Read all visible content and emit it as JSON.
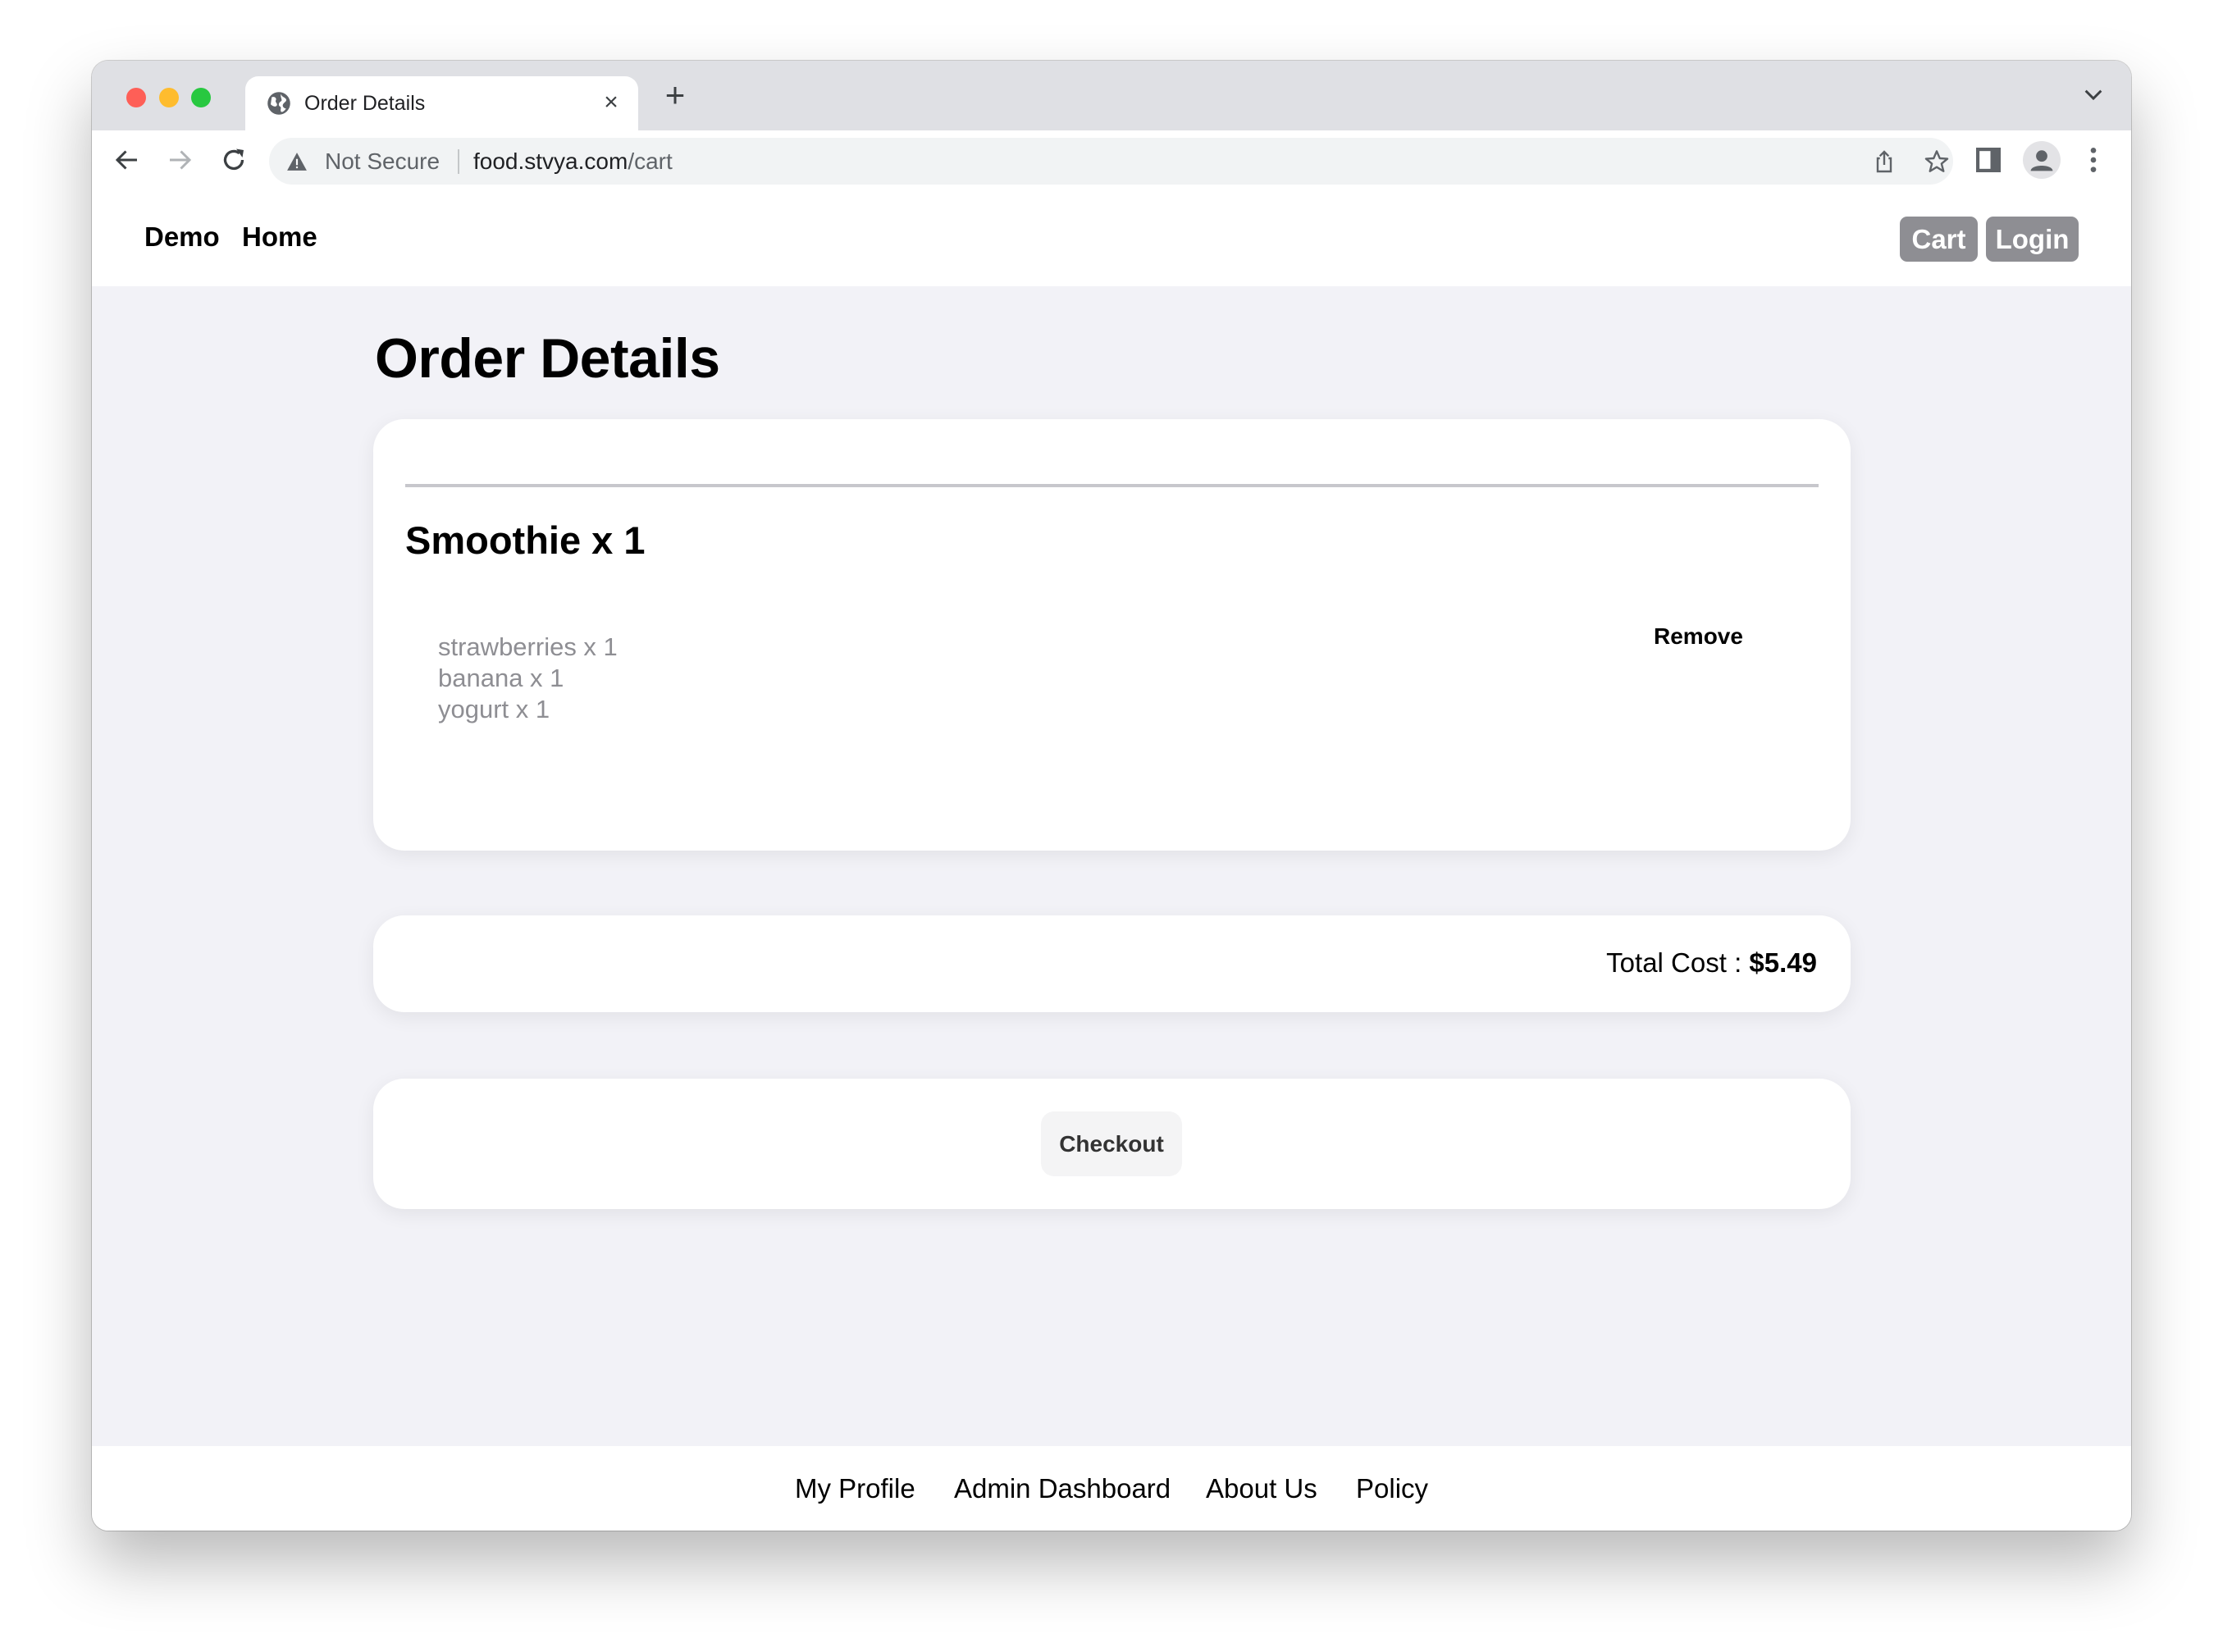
{
  "browser": {
    "tab_title": "Order Details",
    "tab_close": "×",
    "new_tab": "+",
    "security_label": "Not Secure",
    "url_host": "food.stvya.com",
    "url_path": "/cart",
    "icons": [
      "globe-icon",
      "close-icon",
      "plus-icon",
      "chevron-down-icon",
      "back-arrow-icon",
      "forward-arrow-icon",
      "reload-icon",
      "warning-icon",
      "share-icon",
      "star-icon",
      "sidebar-icon",
      "profile-icon",
      "more-vert-icon"
    ]
  },
  "nav": {
    "brand": "Demo",
    "home": "Home",
    "cart": "Cart",
    "login": "Login"
  },
  "page": {
    "title": "Order Details"
  },
  "order": {
    "items": [
      {
        "name": "Smoothie x 1",
        "ingredients": [
          "strawberries x 1",
          "banana x 1",
          "yogurt x 1"
        ],
        "remove_label": "Remove"
      }
    ],
    "total_label": "Total Cost : ",
    "total_value": "$5.49",
    "checkout_label": "Checkout"
  },
  "footer": {
    "links": [
      "My Profile",
      "Admin Dashboard",
      "About Us",
      "Policy"
    ]
  },
  "colors": {
    "page_bg": "#f2f2f7",
    "pill_button": "#8e8e93",
    "ingredient_text": "#8e8e93",
    "divider": "#c7c7cc"
  }
}
